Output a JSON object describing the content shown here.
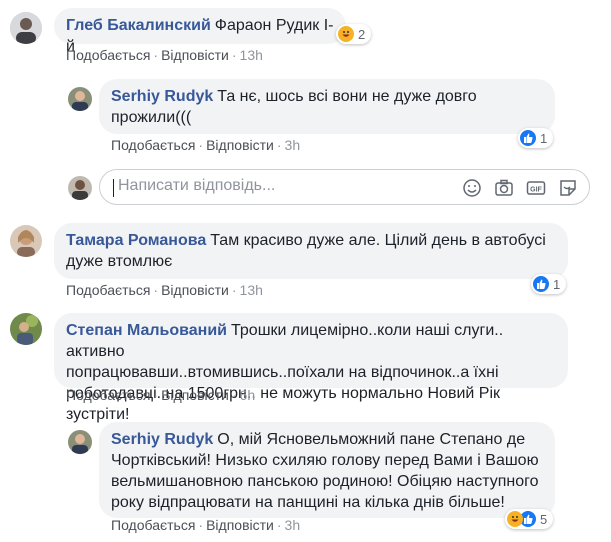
{
  "comments": [
    {
      "author": "Глеб Бакалинский",
      "text": "Фараон Рудик І-й",
      "like_label": "Подобається",
      "reply_label": "Відповісти",
      "time": "13h",
      "reaction_count": "2",
      "reaction_type": "haha"
    },
    {
      "author": "Serhiy Rudyk",
      "text_line1": "Та нє, шось всі вони не дуже довго",
      "text_line2": "прожили(((",
      "like_label": "Подобається",
      "reply_label": "Відповісти",
      "time": "3h",
      "reaction_count": "1",
      "reaction_type": "like"
    },
    {
      "author": "Тамара Романова",
      "text_line1": "Там красиво дуже але. Цілий день в автобусі",
      "text_line2": "дуже втомлює",
      "like_label": "Подобається",
      "reply_label": "Відповісти",
      "time": "13h",
      "reaction_count": "1",
      "reaction_type": "like"
    },
    {
      "author": "Степан Мальований",
      "text_line1": "Трошки лицемірно..коли наші слуги.. активно",
      "text_line2": "попрацювавши..втомившись..поїхали на відпочинок..а їхні",
      "text_line3": "роботодавці..на 1500грн.. не можуть нормально Новий Рік зустріти!",
      "like_label": "Подобається",
      "reply_label": "Відповісти",
      "time": "6h"
    },
    {
      "author": "Serhiy Rudyk",
      "text_line1": "О, мій Ясновельможний пане Степано де",
      "text_line2": "Чортківський! Низько схиляю голову перед Вами і Вашою",
      "text_line3": "вельмишановною панською родиною! Обіцяю наступного",
      "text_line4": "року відпрацювати на панщині на кілька днів більше!",
      "like_label": "Подобається",
      "reply_label": "Відповісти",
      "time": "3h",
      "reaction_count": "5",
      "reaction_type": "haha+like"
    }
  ],
  "reply_box": {
    "placeholder": "Написати відповідь..."
  },
  "colors": {
    "author_link": "#385898",
    "bubble_bg": "#f2f3f5",
    "meta_text": "#90949c",
    "like_blue": "#1877f2",
    "haha_yellow": "#f7b125"
  },
  "icons": [
    "emoji-icon",
    "camera-icon",
    "gif-icon",
    "sticker-icon",
    "like-reaction-icon",
    "haha-reaction-icon"
  ]
}
